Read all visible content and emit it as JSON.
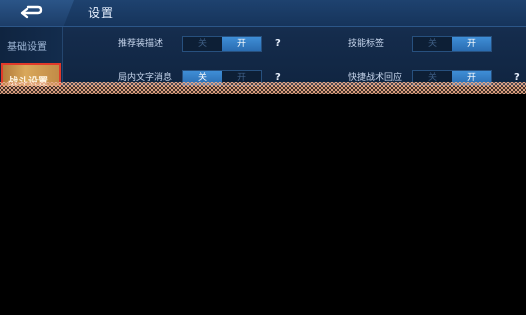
{
  "header": {
    "title": "设置"
  },
  "sidebar": {
    "items": [
      {
        "label": "基础设置"
      },
      {
        "label": "战斗设置"
      }
    ]
  },
  "settings": {
    "left": [
      {
        "label": "推荐装描述",
        "off": "关",
        "on": "开",
        "selected": "on",
        "help": "?"
      },
      {
        "label": "局内文字消息",
        "off": "关",
        "on": "开",
        "selected": "off",
        "help": "?"
      }
    ],
    "right": [
      {
        "label": "技能标签",
        "off": "关",
        "on": "开",
        "selected": "on",
        "help": "?"
      },
      {
        "label": "快捷战术回应",
        "off": "关",
        "on": "开",
        "selected": "on",
        "help": "?"
      }
    ]
  }
}
